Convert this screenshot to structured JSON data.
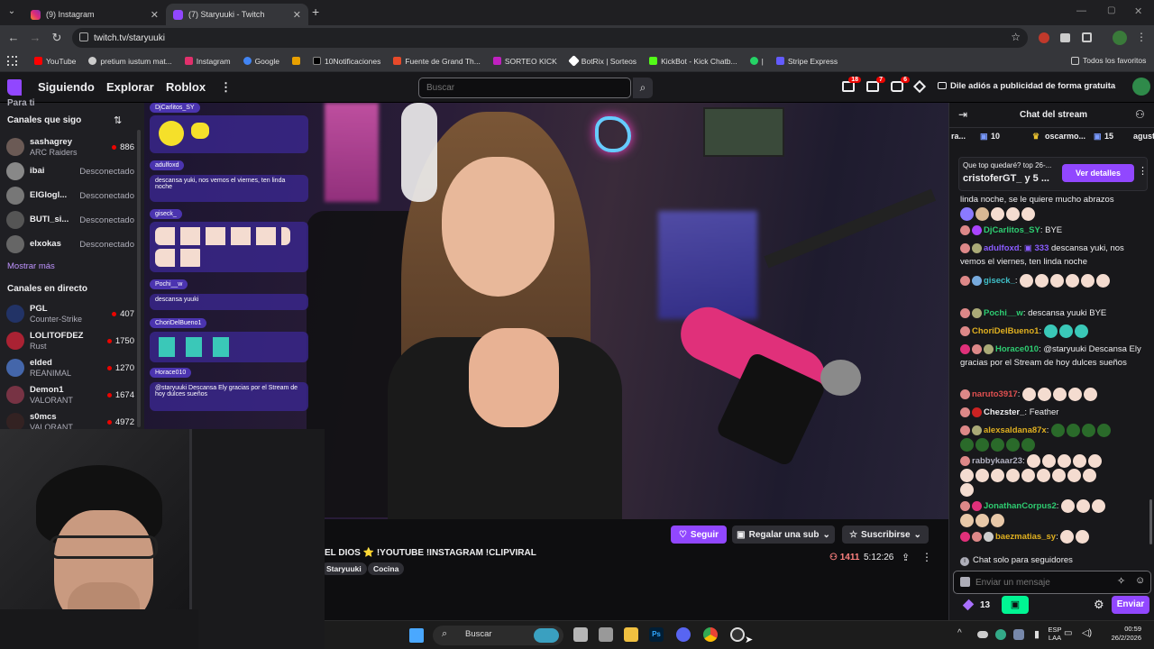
{
  "browser": {
    "tabs": [
      {
        "label": "(9) Instagram",
        "active": false
      },
      {
        "label": "(7) Staryuuki - Twitch",
        "active": true
      }
    ],
    "new_tab_label": "+",
    "url": "twitch.tv/staryuuki",
    "bookmarks": [
      {
        "label": "YouTube",
        "color": "#ff0000"
      },
      {
        "label": "pretium iustum mat...",
        "color": "#cccccc"
      },
      {
        "label": "Instagram",
        "color": "#e1306c"
      },
      {
        "label": "Google",
        "color": "#4285f4"
      },
      {
        "label": "",
        "color": "#e8a000"
      },
      {
        "label": "10Notificaciones",
        "color": "#000000"
      },
      {
        "label": "Fuente de Grand Th...",
        "color": "#e84a2a"
      },
      {
        "label": "SORTEO KICK",
        "color": "#c020c0"
      },
      {
        "label": "BotRix | Sorteos",
        "color": "#ffffff"
      },
      {
        "label": "KickBot - Kick Chatb...",
        "color": "#53fc18"
      },
      {
        "label": "|",
        "color": "#25d366"
      },
      {
        "label": "Stripe Express",
        "color": "#635bff"
      }
    ],
    "all_favorites": "Todos los favoritos"
  },
  "twitch": {
    "nav": {
      "following": "Siguiendo",
      "browse": "Explorar",
      "roblox": "Roblox",
      "more": "⋮"
    },
    "search_placeholder": "Buscar",
    "notifications": [
      {
        "icon": "inbox-icon",
        "count": "18"
      },
      {
        "icon": "prime-icon",
        "count": "7"
      },
      {
        "icon": "whispers-icon",
        "count": "6"
      }
    ],
    "ad_free_text": "Dile adiós a publicidad de forma gratuita",
    "accent": "#9147ff"
  },
  "sidebar": {
    "clipped_title": "Para ti",
    "followed_header": "Canales que sigo",
    "followed": [
      {
        "name": "sashagrey",
        "sub": "ARC Raiders",
        "status": "886",
        "live": true,
        "color": "#6b5a55"
      },
      {
        "name": "ibai",
        "sub": "",
        "status": "Desconectado",
        "live": false,
        "color": "#888888"
      },
      {
        "name": "ElGlogl...",
        "sub": "",
        "status": "Desconectado",
        "live": false,
        "color": "#777777"
      },
      {
        "name": "BUTI_si...",
        "sub": "",
        "status": "Desconectado",
        "live": false,
        "color": "#555555"
      },
      {
        "name": "elxokas",
        "sub": "",
        "status": "Desconectado",
        "live": false,
        "color": "#666666"
      }
    ],
    "show_more": "Mostrar más",
    "live_header": "Canales en directo",
    "live": [
      {
        "name": "PGL",
        "sub": "Counter-Strike",
        "status": "407",
        "color": "#223366"
      },
      {
        "name": "LOLITOFDEZ",
        "sub": "Rust",
        "status": "1750",
        "color": "#aa2233"
      },
      {
        "name": "elded",
        "sub": "REANIMAL",
        "status": "1270",
        "color": "#4466aa"
      },
      {
        "name": "Demon1",
        "sub": "VALORANT",
        "status": "1674",
        "color": "#773344"
      },
      {
        "name": "s0mcs",
        "sub": "VALORANT",
        "status": "4972",
        "color": "#332222"
      }
    ]
  },
  "overlay_chat": [
    {
      "name": "DjCarlitos_SY",
      "text": ""
    },
    {
      "name": "adulfoxd",
      "text": "descansa yuki, nos vemos el viernes, ten linda noche"
    },
    {
      "name": "giseck_",
      "text": ""
    },
    {
      "name": "Pochi__w",
      "text": "descansa yuuki"
    },
    {
      "name": "ChoriDelBueno1",
      "text": ""
    },
    {
      "name": "Horace010",
      "text": "@staryuuki Descansa Ely gracias por el Stream de hoy dulces sueños"
    }
  ],
  "stream": {
    "title": "EL DIOS ⭐ !YOUTUBE !INSTAGRAM !CLIPVIRAL",
    "tags": [
      "Staryuuki",
      "Cocina"
    ],
    "follow_label": "Seguir",
    "gift_label": "Regalar una sub",
    "subscribe_label": "Suscribirse",
    "viewers": "1411",
    "uptime": "5:12:26"
  },
  "chat": {
    "title": "Chat del stream",
    "gift_leaders": [
      {
        "name": "ra...",
        "count": "10"
      },
      {
        "name": "oscarmo...",
        "count": "15"
      },
      {
        "name": "agust",
        "count": ""
      }
    ],
    "prediction_question": "Que top quedaré? top 26-...",
    "prediction_users": "cristoferGT_ y 5 ...",
    "prediction_button": "Ver detalles",
    "messages": [
      {
        "user": "",
        "color": "#efeff1",
        "text": "linda noche, se le quiere mucho abrazos"
      },
      {
        "user": "DjCarlitos_SY",
        "color": "#2ecc71",
        "text": "BYE"
      },
      {
        "user": "adulfoxd",
        "color": "#8a5cff",
        "badge": "333",
        "text": "descansa yuki, nos vemos el viernes, ten linda noche"
      },
      {
        "user": "giseck_",
        "color": "#3fbfc8",
        "text": ""
      },
      {
        "user": "Pochi__w",
        "color": "#2ecc71",
        "text": "descansa yuuki BYE"
      },
      {
        "user": "ChoriDelBueno1",
        "color": "#e0b020",
        "text": ""
      },
      {
        "user": "Horace010",
        "color": "#2ecc71",
        "text": "@staryuuki Descansa Ely gracias por el Stream de hoy dulces sueños"
      },
      {
        "user": "naruto3917",
        "color": "#e05050",
        "text": ""
      },
      {
        "user": "Chezster_",
        "color": "#efeff1",
        "text": "Feather"
      },
      {
        "user": "alexsaldana87x",
        "color": "#e0b020",
        "text": ""
      },
      {
        "user": "rabbykaar23",
        "color": "#b0b0c0",
        "text": ""
      },
      {
        "user": "JonathanCorpus2",
        "color": "#2ecc71",
        "text": ""
      },
      {
        "user": "baezmatias_sy",
        "color": "#e0b020",
        "text": ""
      }
    ],
    "followers_only": "Chat solo para seguidores",
    "input_placeholder": "Enviar un mensaje",
    "points": "13",
    "send_label": "Enviar"
  },
  "taskbar": {
    "search_label": "Buscar",
    "language": "ESP",
    "language_sub": "LAA",
    "time": "00:59",
    "date": "26/2/2026"
  }
}
